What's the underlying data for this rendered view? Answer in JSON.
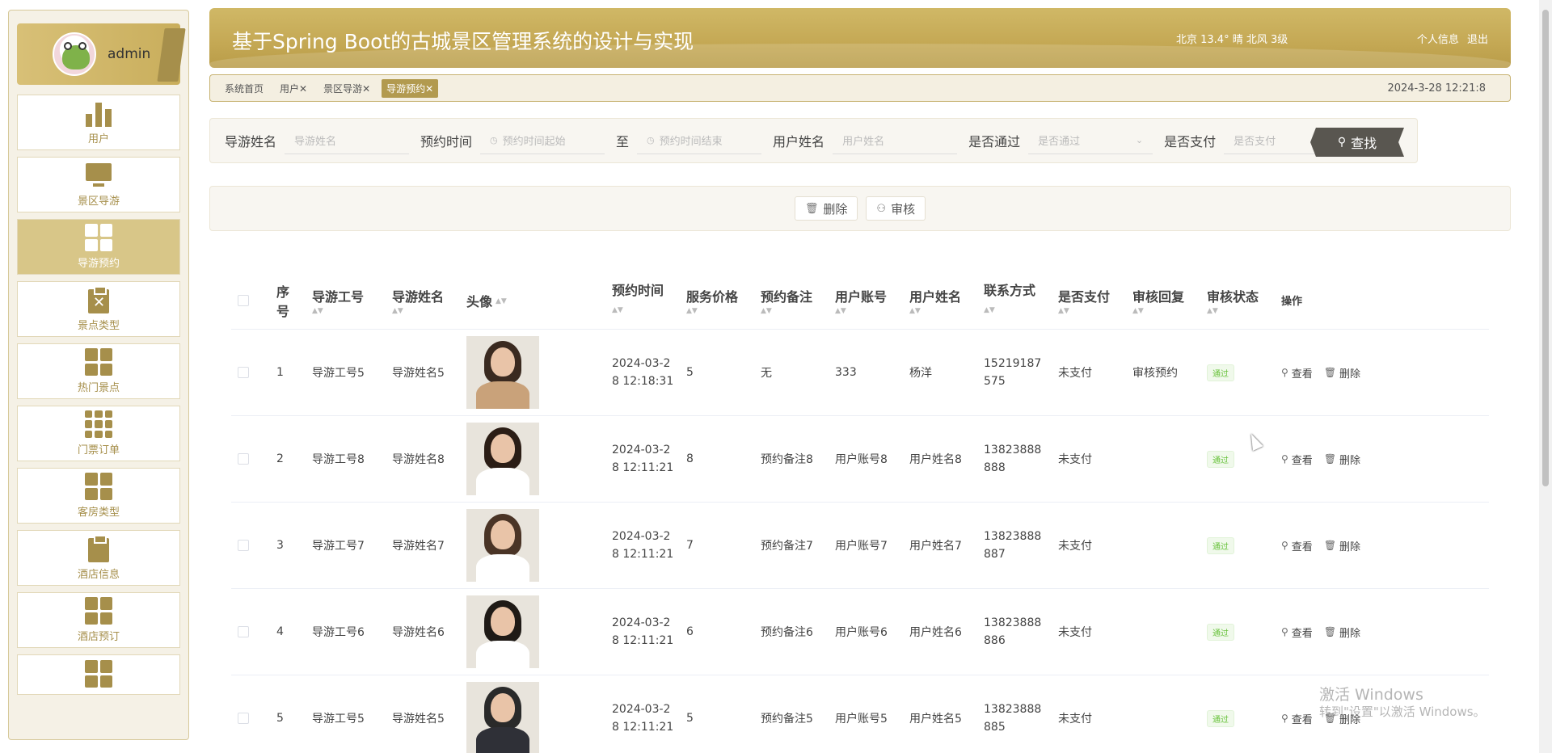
{
  "user": {
    "name": "admin"
  },
  "sidebar": {
    "items": [
      {
        "label": "用户",
        "icon": "bar-chart-icon"
      },
      {
        "label": "景区导游",
        "icon": "monitor-icon"
      },
      {
        "label": "导游预约",
        "icon": "grid-icon",
        "active": true
      },
      {
        "label": "景点类型",
        "icon": "clipboard-x-icon"
      },
      {
        "label": "热门景点",
        "icon": "grid-icon"
      },
      {
        "label": "门票订单",
        "icon": "grid-nine-icon"
      },
      {
        "label": "客房类型",
        "icon": "grid-icon"
      },
      {
        "label": "酒店信息",
        "icon": "clipboard-icon"
      },
      {
        "label": "酒店预订",
        "icon": "grid-icon"
      },
      {
        "label": "",
        "icon": "grid-icon"
      }
    ]
  },
  "header": {
    "title": "基于Spring Boot的古城景区管理系统的设计与实现",
    "weather": "北京  13.4°  晴  北风  3级",
    "profile_link": "个人信息",
    "logout_link": "退出"
  },
  "tags": {
    "items": [
      "系统首页",
      "用户✕",
      "景区导游✕",
      "导游预约✕"
    ],
    "datetime": "2024-3-28 12:21:8"
  },
  "search": {
    "guide_name_label": "导游姓名",
    "guide_name_placeholder": "导游姓名",
    "time_label": "预约时间",
    "time_start_placeholder": "预约时间起始",
    "to_label": "至",
    "time_end_placeholder": "预约时间结束",
    "user_name_label": "用户姓名",
    "user_name_placeholder": "用户姓名",
    "passed_label": "是否通过",
    "passed_placeholder": "是否通过",
    "paid_label": "是否支付",
    "paid_placeholder": "是否支付",
    "search_button": "查找"
  },
  "actions": {
    "delete": "删除",
    "audit": "审核"
  },
  "table": {
    "headers": {
      "index": [
        "序",
        "号"
      ],
      "guide_no": "导游工号",
      "guide_name": "导游姓名",
      "avatar": "头像",
      "time": "预约时间",
      "price": "服务价格",
      "note": "预约备注",
      "user_account": "用户账号",
      "user_name": "用户姓名",
      "phone": "联系方式",
      "paid": "是否支付",
      "reply": "审核回复",
      "status": "审核状态",
      "ops": "操作"
    },
    "view_label": "查看",
    "delete_label": "删除",
    "rows": [
      {
        "index": "1",
        "guide_no": "导游工号5",
        "guide_name": "导游姓名5",
        "time1": "2024-03-2",
        "time2": "8 12:18:31",
        "price": "5",
        "note": "无",
        "user_account": "333",
        "user_name": "杨洋",
        "phone1": "15219187",
        "phone2": "575",
        "paid": "未支付",
        "reply": "审核预约",
        "status": "通过"
      },
      {
        "index": "2",
        "guide_no": "导游工号8",
        "guide_name": "导游姓名8",
        "time1": "2024-03-2",
        "time2": "8 12:11:21",
        "price": "8",
        "note": "预约备注8",
        "user_account": "用户账号8",
        "user_name": "用户姓名8",
        "phone1": "13823888",
        "phone2": "888",
        "paid": "未支付",
        "reply": "",
        "status": "通过"
      },
      {
        "index": "3",
        "guide_no": "导游工号7",
        "guide_name": "导游姓名7",
        "time1": "2024-03-2",
        "time2": "8 12:11:21",
        "price": "7",
        "note": "预约备注7",
        "user_account": "用户账号7",
        "user_name": "用户姓名7",
        "phone1": "13823888",
        "phone2": "887",
        "paid": "未支付",
        "reply": "",
        "status": "通过"
      },
      {
        "index": "4",
        "guide_no": "导游工号6",
        "guide_name": "导游姓名6",
        "time1": "2024-03-2",
        "time2": "8 12:11:21",
        "price": "6",
        "note": "预约备注6",
        "user_account": "用户账号6",
        "user_name": "用户姓名6",
        "phone1": "13823888",
        "phone2": "886",
        "paid": "未支付",
        "reply": "",
        "status": "通过"
      },
      {
        "index": "5",
        "guide_no": "导游工号5",
        "guide_name": "导游姓名5",
        "time1": "2024-03-2",
        "time2": "8 12:11:21",
        "price": "5",
        "note": "预约备注5",
        "user_account": "用户账号5",
        "user_name": "用户姓名5",
        "phone1": "13823888",
        "phone2": "885",
        "paid": "未支付",
        "reply": "",
        "status": "通过"
      }
    ]
  },
  "watermark": {
    "line1": "激活 Windows",
    "line2": "转到\"设置\"以激活 Windows。"
  }
}
